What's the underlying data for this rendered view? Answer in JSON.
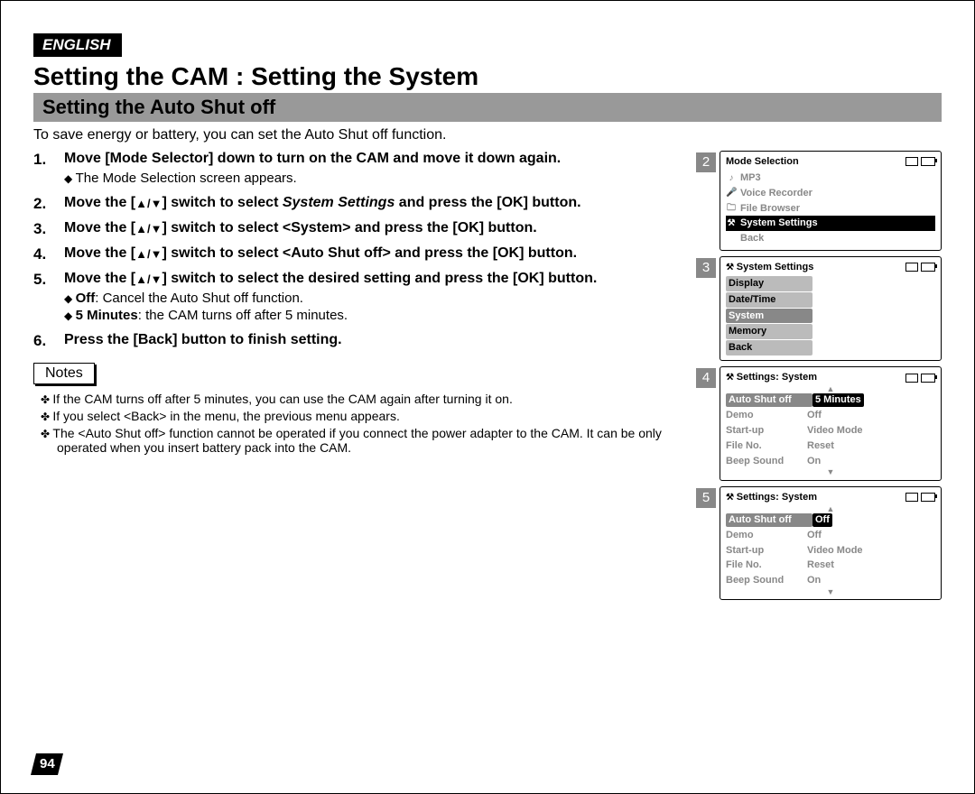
{
  "lang_badge": "ENGLISH",
  "title": "Setting the CAM : Setting the System",
  "subtitle": "Setting the Auto Shut off",
  "intro": "To save energy or battery, you can set the Auto Shut off function.",
  "arrows": "▲/▼",
  "steps": {
    "s1": {
      "main": "Move [Mode Selector] down to turn on the CAM and move it down again.",
      "sub1": "The Mode Selection screen appears."
    },
    "s2": {
      "pre": "Move the [",
      "post": "] switch to select ",
      "em": "System Settings",
      "tail": " and press the [OK] button."
    },
    "s3": {
      "pre": "Move the [",
      "post": "] switch to select <System> and press the [OK] button."
    },
    "s4": {
      "pre": "Move the [",
      "post": "] switch to select <Auto Shut off> and press the [OK] button."
    },
    "s5": {
      "pre": "Move the [",
      "post": "] switch to select the desired setting and press the [OK] button.",
      "sub1_b": "Off",
      "sub1_t": ": Cancel the Auto Shut off function.",
      "sub2_b": "5 Minutes",
      "sub2_t": ": the CAM turns off after 5 minutes."
    },
    "s6": "Press the [Back] button to finish setting."
  },
  "notes_label": "Notes",
  "notes": {
    "n1": "If the CAM turns off after 5 minutes, you can use the CAM again after turning it on.",
    "n2": "If you select <Back> in the menu, the previous menu appears.",
    "n3": "The <Auto Shut off> function cannot be operated if you connect the power adapter to the CAM. It can be only operated when you insert battery pack into the CAM."
  },
  "page_number": "94",
  "screens": {
    "s2": {
      "badge": "2",
      "title": "Mode Selection",
      "items": {
        "mp3": "MP3",
        "voice": "Voice Recorder",
        "file": "File Browser",
        "sys": "System Settings",
        "back": "Back"
      }
    },
    "s3": {
      "badge": "3",
      "title": "System Settings",
      "items": {
        "display": "Display",
        "datetime": "Date/Time",
        "system": "System",
        "memory": "Memory",
        "back": "Back"
      }
    },
    "s4": {
      "badge": "4",
      "title": "Settings: System",
      "rows": {
        "r1k": "Auto Shut off",
        "r1v": "5 Minutes",
        "r2k": "Demo",
        "r2v": "Off",
        "r3k": "Start-up",
        "r3v": "Video Mode",
        "r4k": "File No.",
        "r4v": "Reset",
        "r5k": "Beep Sound",
        "r5v": "On"
      }
    },
    "s5": {
      "badge": "5",
      "title": "Settings: System",
      "rows": {
        "r1k": "Auto Shut off",
        "r1v": "Off",
        "r2k": "Demo",
        "r2v": "Off",
        "r3k": "Start-up",
        "r3v": "Video Mode",
        "r4k": "File No.",
        "r4v": "Reset",
        "r5k": "Beep Sound",
        "r5v": "On"
      }
    }
  }
}
